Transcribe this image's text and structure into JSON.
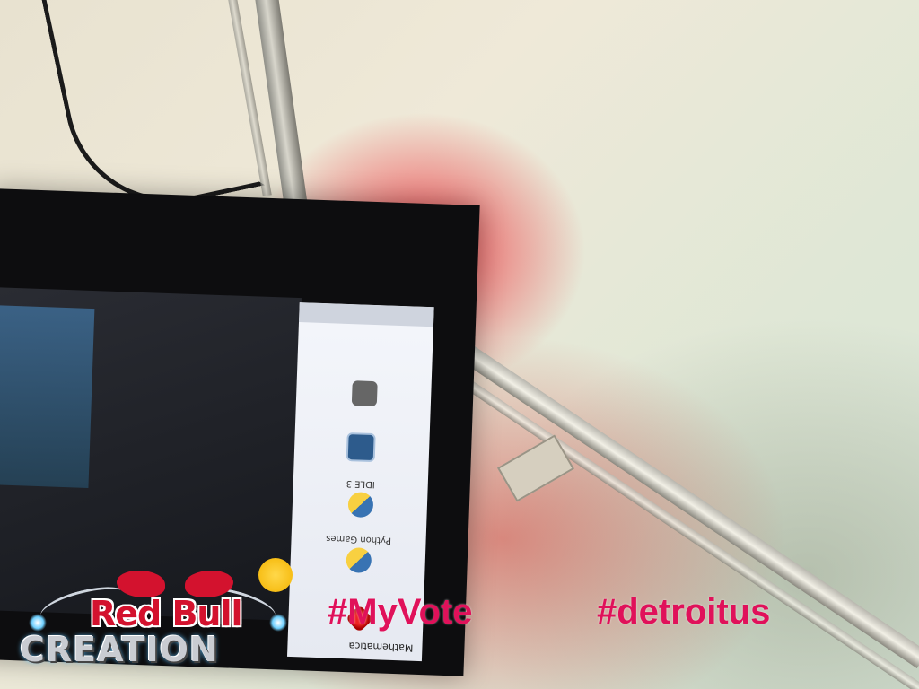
{
  "overlay": {
    "brand_top": "Red Bull",
    "brand_bottom": "CREATION",
    "hashtag_1": "#MyVote",
    "hashtag_2": "#detroitus"
  },
  "screen_menu": {
    "header": "Mathematica",
    "items": [
      {
        "label": "",
        "icon": "mathematica-icon"
      },
      {
        "label": "Python Games",
        "icon": "python-icon"
      },
      {
        "label": "IDLE 3",
        "icon": "python-icon"
      },
      {
        "label": "",
        "icon": "terminal-icon"
      },
      {
        "label": "",
        "icon": "app-icon"
      }
    ]
  },
  "colors": {
    "hashtag": "#e0115a",
    "brand_red": "#d3122e",
    "brand_gold": "#f4b300"
  }
}
